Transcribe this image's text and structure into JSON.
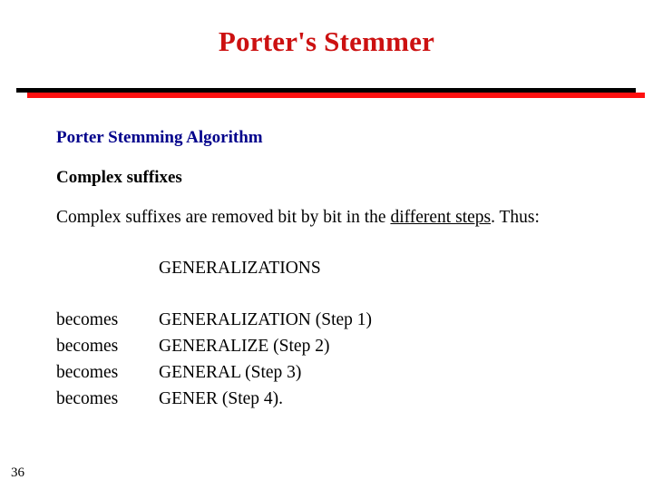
{
  "slide": {
    "title": "Porter's Stemmer",
    "title_color": "#cc1111",
    "divider": {
      "shadow_color": "#000000",
      "accent_color": "#ff1010"
    },
    "heading_blue": "Porter Stemming Algorithm",
    "heading_blue_color": "#00008b",
    "heading_black": "Complex suffixes",
    "paragraph": {
      "before": "Complex suffixes are removed bit by bit in the ",
      "underlined": "different steps",
      "after": ". Thus:"
    },
    "example_word": "GENERALIZATIONS",
    "steps": [
      {
        "label": "becomes",
        "value": "GENERALIZATION (Step 1)"
      },
      {
        "label": "becomes",
        "value": "GENERALIZE (Step 2)"
      },
      {
        "label": "becomes",
        "value": "GENERAL (Step 3)"
      },
      {
        "label": "becomes",
        "value": "GENER (Step 4)."
      }
    ],
    "page_number": "36"
  }
}
